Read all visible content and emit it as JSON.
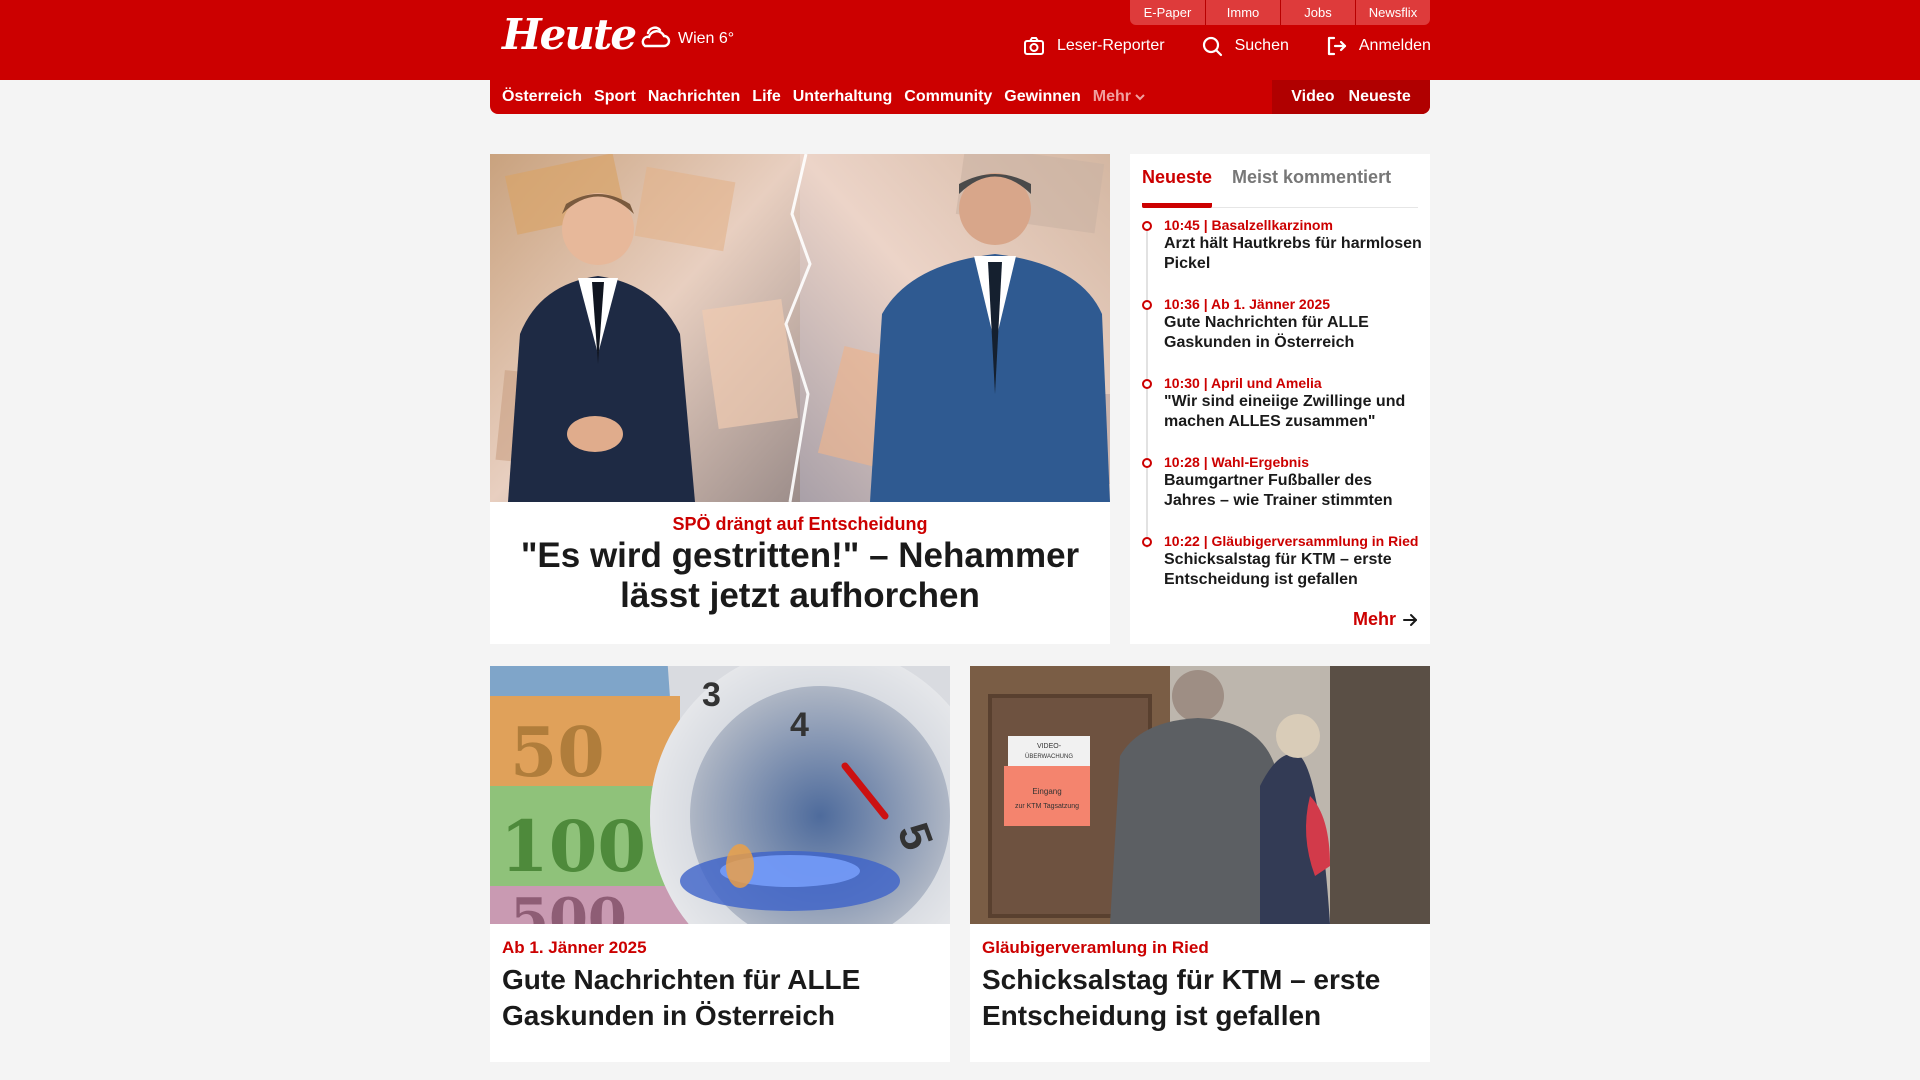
{
  "site": {
    "logo_text": "Heute",
    "weather": "Wien 6°"
  },
  "services": [
    "E-Paper",
    "Immo",
    "Jobs",
    "Newsflix"
  ],
  "actions": [
    {
      "label": "Leser-Reporter",
      "icon": "camera-icon"
    },
    {
      "label": "Suchen",
      "icon": "search-icon"
    },
    {
      "label": "Anmelden",
      "icon": "login-icon"
    }
  ],
  "nav": {
    "items": [
      "Österreich",
      "Sport",
      "Nachrichten",
      "Life",
      "Unterhaltung",
      "Community",
      "Gewinnen"
    ],
    "more_label": "Mehr",
    "right": [
      "Video",
      "Neueste"
    ]
  },
  "hero": {
    "kicker": "SPÖ drängt auf Entscheidung",
    "title": "\"Es wird gestritten!\" – Nehammer lässt jetzt aufhorchen"
  },
  "latest": {
    "tabs": [
      "Neueste",
      "Meist kommentiert"
    ],
    "items": [
      {
        "time": "10:45",
        "topic": "Basalzellkarzinom",
        "title": "Arzt hält Hautkrebs für harmlosen Pickel"
      },
      {
        "time": "10:36",
        "topic": "Ab 1. Jänner 2025",
        "title": "Gute Nachrichten für ALLE Gaskunden in Österreich"
      },
      {
        "time": "10:30",
        "topic": "April und Amelia",
        "title": "\"Wir sind eineiige Zwillinge und machen ALLES zusammen\""
      },
      {
        "time": "10:28",
        "topic": "Wahl-Ergebnis",
        "title": "Baumgartner Fußballer des Jahres – wie Trainer stimmten"
      },
      {
        "time": "10:22",
        "topic": "Gläubigerversammlung in Ried",
        "title": "Schicksalstag für KTM – erste Entscheidung ist gefallen"
      }
    ],
    "more_label": "Mehr"
  },
  "cards": [
    {
      "kicker": "Ab 1. Jänner 2025",
      "title": "Gute Nachrichten für ALLE Gaskunden in Österreich"
    },
    {
      "kicker": "Gläubigerveramlung in Ried",
      "title": "Schicksalstag für KTM – erste Entscheidung ist gefallen"
    }
  ],
  "images": {
    "gas_dial_labels": [
      "3",
      "4",
      "5"
    ],
    "euro_notes": [
      "50",
      "100",
      "500"
    ],
    "door_sign": [
      "VIDEO-",
      "ÜBERWACHUNG",
      "Eingang",
      "zur KTM Tagsatzung"
    ]
  },
  "colors": {
    "brand_red": "#cc0000",
    "dark_red": "#b00000",
    "light_red": "#de3b3b"
  }
}
